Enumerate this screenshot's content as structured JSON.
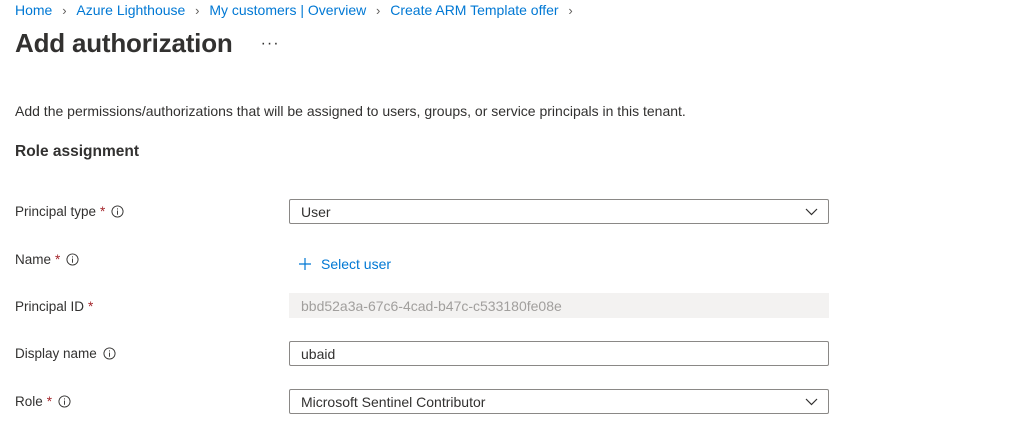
{
  "breadcrumb": [
    "Home",
    "Azure Lighthouse",
    "My customers | Overview",
    "Create ARM Template offer"
  ],
  "page": {
    "title": "Add authorization",
    "more_label": "···",
    "description": "Add the permissions/authorizations that will be assigned to users, groups, or service principals in this tenant."
  },
  "section": {
    "title": "Role assignment"
  },
  "form": {
    "principal_type": {
      "label": "Principal type",
      "required_mark": "*",
      "value": "User"
    },
    "name": {
      "label": "Name",
      "required_mark": "*",
      "action_label": "Select user"
    },
    "principal_id": {
      "label": "Principal ID",
      "required_mark": "*",
      "value": "bbd52a3a-67c6-4cad-b47c-c533180fe08e"
    },
    "display_name": {
      "label": "Display name",
      "value": "ubaid"
    },
    "role": {
      "label": "Role",
      "required_mark": "*",
      "value": "Microsoft Sentinel Contributor"
    }
  },
  "colors": {
    "link": "#0078d4",
    "required": "#a4262c",
    "text": "#323130",
    "readonly_bg": "#f3f2f1"
  },
  "icons": [
    "chevron-right-icon",
    "info-icon",
    "chevron-down-icon",
    "plus-icon"
  ]
}
